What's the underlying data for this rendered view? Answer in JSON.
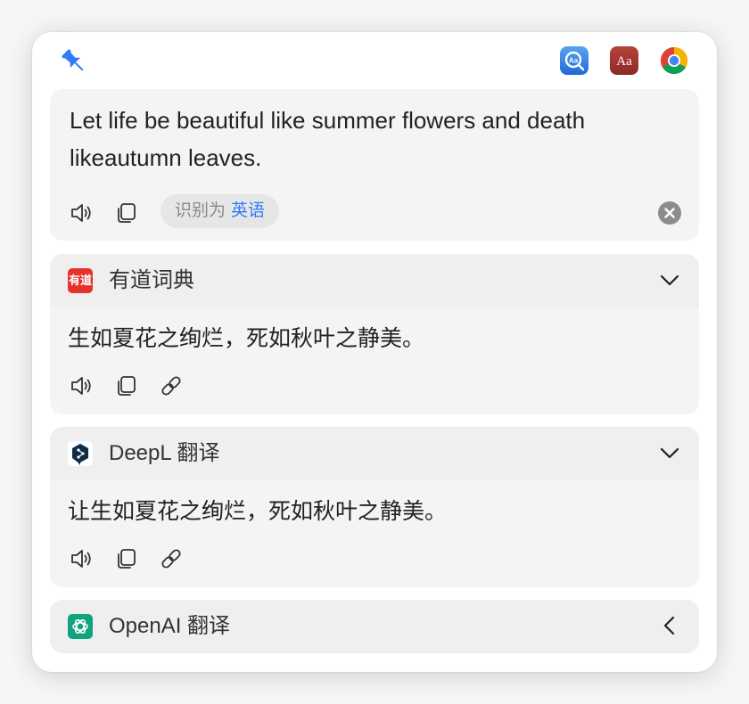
{
  "source": {
    "text": "Let life be beautiful like summer flowers and death likeautumn leaves.",
    "detect_label": "识别为",
    "detect_lang": "英语"
  },
  "services": [
    {
      "name": "有道词典",
      "logo_text": "有道",
      "result": "生如夏花之绚烂，死如秋叶之静美。",
      "expanded": true
    },
    {
      "name": "DeepL 翻译",
      "result": "让生如夏花之绚烂，死如秋叶之静美。",
      "expanded": true
    },
    {
      "name": "OpenAI 翻译",
      "expanded": false
    }
  ],
  "top_icons": [
    "pin-icon",
    "dictionary-app-icon",
    "aa-dictionary-icon",
    "chrome-icon"
  ],
  "colors": {
    "accent": "#2f7cf6",
    "youdao": "#e5322d",
    "openai": "#10a37f",
    "deepl": "#0f2b46"
  }
}
